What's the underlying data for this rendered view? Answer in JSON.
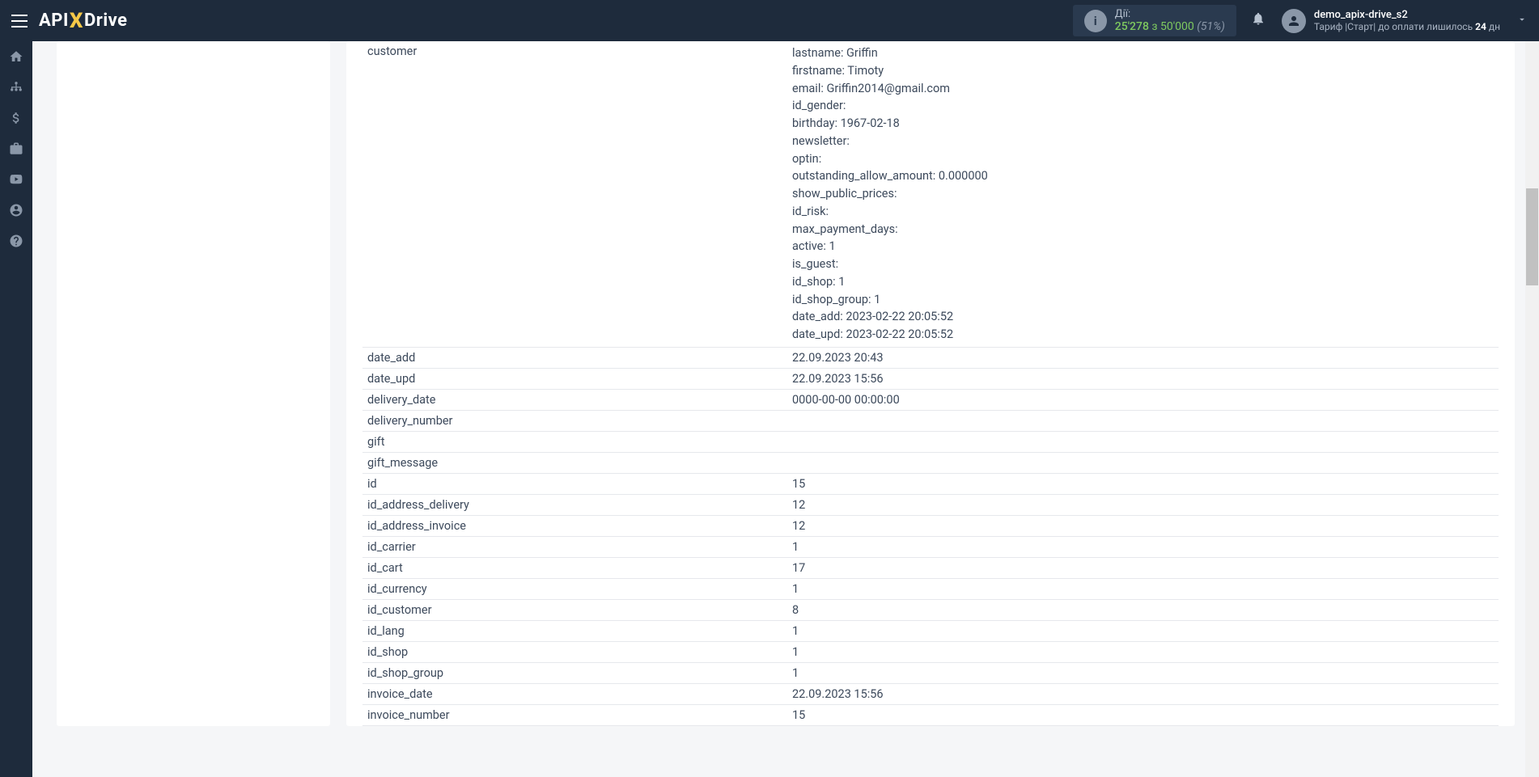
{
  "header": {
    "logo_api": "API",
    "logo_x": "X",
    "logo_drive": "Drive",
    "actions_label": "Дії:",
    "actions_used": "25'278",
    "actions_sep": " з ",
    "actions_total": "50'000",
    "actions_pct": "(51%)",
    "user_name": "demo_apix-drive_s2",
    "plan_prefix": "Тариф |Старт| до оплати лишилось ",
    "plan_days": "24",
    "plan_suffix": " дн"
  },
  "customer_key": "customer",
  "customer_lines": [
    "lastname: Griffin",
    "firstname: Timoty",
    "email: Griffin2014@gmail.com",
    "id_gender:",
    "birthday: 1967-02-18",
    "newsletter:",
    "optin:",
    "outstanding_allow_amount: 0.000000",
    "show_public_prices:",
    "id_risk:",
    "max_payment_days:",
    "active: 1",
    "is_guest:",
    "id_shop: 1",
    "id_shop_group: 1",
    "date_add: 2023-02-22 20:05:52",
    "date_upd: 2023-02-22 20:05:52"
  ],
  "rows": [
    {
      "k": "date_add",
      "v": "22.09.2023 20:43"
    },
    {
      "k": "date_upd",
      "v": "22.09.2023 15:56"
    },
    {
      "k": "delivery_date",
      "v": "0000-00-00 00:00:00"
    },
    {
      "k": "delivery_number",
      "v": ""
    },
    {
      "k": "gift",
      "v": ""
    },
    {
      "k": "gift_message",
      "v": ""
    },
    {
      "k": "id",
      "v": "15"
    },
    {
      "k": "id_address_delivery",
      "v": "12"
    },
    {
      "k": "id_address_invoice",
      "v": "12"
    },
    {
      "k": "id_carrier",
      "v": "1"
    },
    {
      "k": "id_cart",
      "v": "17"
    },
    {
      "k": "id_currency",
      "v": "1"
    },
    {
      "k": "id_customer",
      "v": "8"
    },
    {
      "k": "id_lang",
      "v": "1"
    },
    {
      "k": "id_shop",
      "v": "1"
    },
    {
      "k": "id_shop_group",
      "v": "1"
    },
    {
      "k": "invoice_date",
      "v": "22.09.2023 15:56"
    },
    {
      "k": "invoice_number",
      "v": "15"
    }
  ]
}
